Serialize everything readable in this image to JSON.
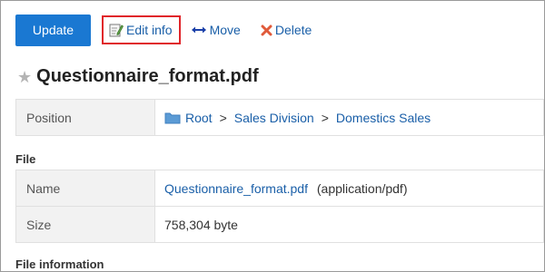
{
  "toolbar": {
    "update_label": "Update",
    "edit_label": "Edit info",
    "move_label": "Move",
    "delete_label": "Delete"
  },
  "file_title": "Questionnaire_format.pdf",
  "position": {
    "label": "Position",
    "path": [
      "Root",
      "Sales Division",
      "Domestics Sales"
    ],
    "separator": ">"
  },
  "file_section": {
    "heading": "File",
    "name_label": "Name",
    "name_value": "Questionnaire_format.pdf",
    "mime_type": "(application/pdf)",
    "size_label": "Size",
    "size_value": "758,304 byte"
  },
  "file_information": {
    "heading": "File information"
  },
  "colors": {
    "accent": "#1a78d2",
    "link": "#1a5fa8",
    "highlight_border": "#e0252a",
    "delete_icon": "#e05a3a",
    "folder_icon": "#5b9bd5"
  },
  "icons": {
    "edit": "edit-icon",
    "move": "move-arrows-icon",
    "delete": "delete-x-icon",
    "star": "star-icon",
    "folder": "folder-icon"
  }
}
